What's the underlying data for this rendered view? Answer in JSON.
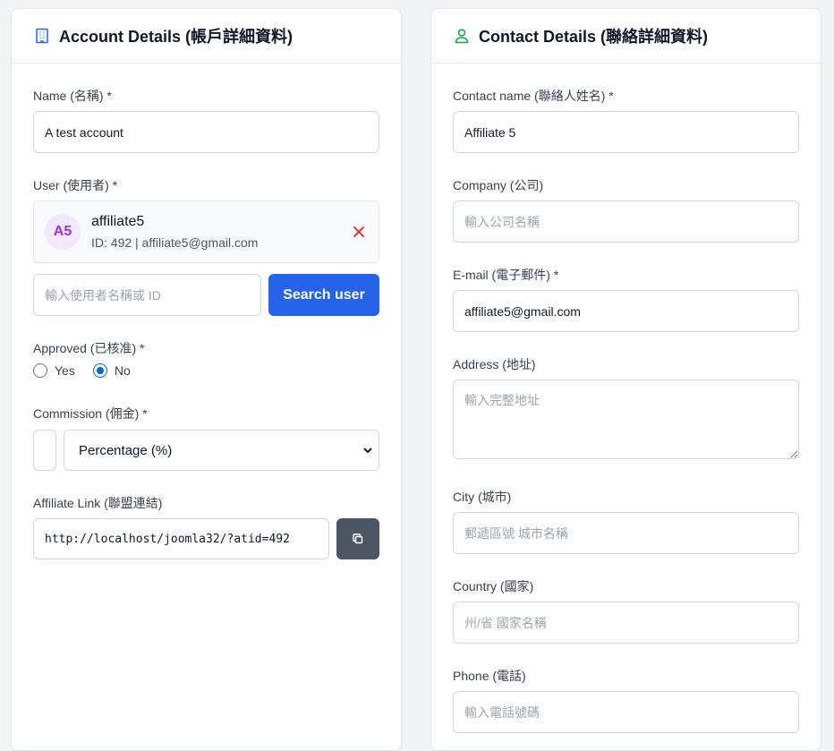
{
  "account": {
    "title": "Account Details (帳戶詳細資料)",
    "name_label": "Name (名稱) *",
    "name_value": "A test account",
    "user_label": "User (使用者) *",
    "user": {
      "initials": "A5",
      "username": "affiliate5",
      "meta": "ID: 492 | affiliate5@gmail.com"
    },
    "search_placeholder": "輸入使用者名稱或 ID",
    "search_button": "Search user",
    "approved_label": "Approved (已核准) *",
    "approved_options": [
      {
        "label": "Yes",
        "checked": false
      },
      {
        "label": "No",
        "checked": true
      }
    ],
    "commission_label": "Commission (佣金) *",
    "commission_type": "Percentage (%)",
    "affiliate_link_label": "Affiliate Link (聯盟連結)",
    "affiliate_link": "http://localhost/joomla32/?atid=492"
  },
  "contact": {
    "title": "Contact Details (聯絡詳細資料)",
    "contact_name_label": "Contact name (聯絡人姓名) *",
    "contact_name_value": "Affiliate 5",
    "company_label": "Company (公司)",
    "company_placeholder": "輸入公司名稱",
    "email_label": "E-mail (電子郵件) *",
    "email_value": "affiliate5@gmail.com",
    "address_label": "Address (地址)",
    "address_placeholder": "輸入完整地址",
    "city_label": "City (城市)",
    "city_placeholder": "郵遞區號 城市名稱",
    "country_label": "Country (國家)",
    "country_placeholder": "州/省 國家名稱",
    "phone_label": "Phone (電話)",
    "phone_placeholder": "輸入電話號碼"
  },
  "icons": {
    "account_header": "building-icon",
    "contact_header": "user-icon",
    "remove_user": "close-icon",
    "copy_link": "copy-icon"
  },
  "colors": {
    "primary": "#2563eb",
    "avatar_bg": "#f3e8ff",
    "avatar_text": "#9333ea",
    "remove": "#dc2626",
    "copy_button": "#4b5563",
    "contact_icon": "#16a34a"
  }
}
